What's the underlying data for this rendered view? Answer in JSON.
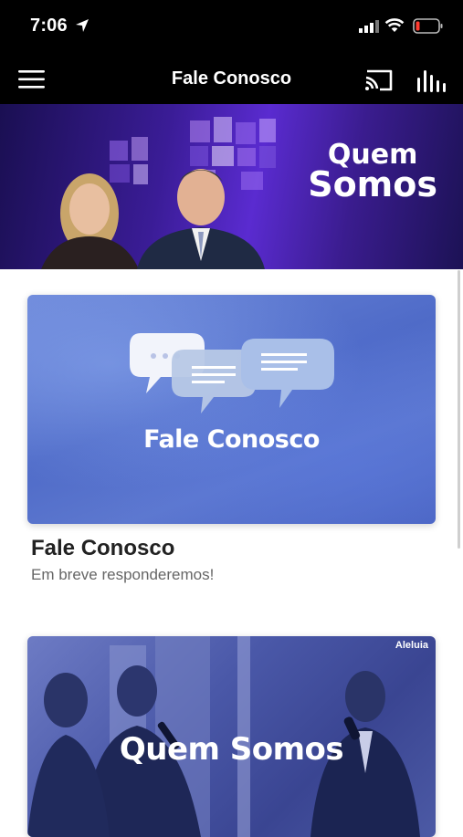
{
  "status_bar": {
    "time": "7:06"
  },
  "nav": {
    "title": "Fale Conosco"
  },
  "hero": {
    "title_line1": "Quem",
    "title_line2": "Somos"
  },
  "cards": [
    {
      "image_title": "Fale Conosco",
      "title": "Fale Conosco",
      "subtitle": "Em breve responderemos!"
    },
    {
      "image_title": "Quem Somos",
      "badge": "Aleluia"
    }
  ],
  "colors": {
    "bar_bg": "#000000",
    "hero_purple": "#5a2bd0",
    "card_blue": "#5d78cf"
  }
}
